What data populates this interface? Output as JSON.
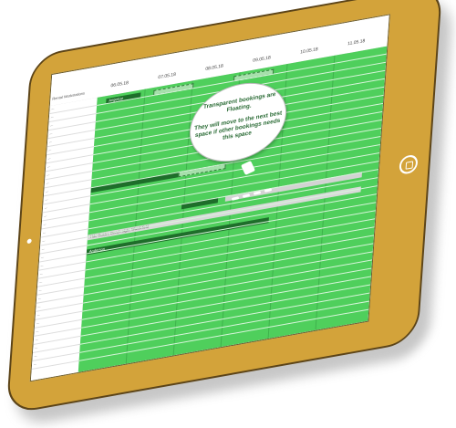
{
  "dates": [
    "06.05.18",
    "07.05.18",
    "08.05.18",
    "09.05.18",
    "10.05.18",
    "11.05.18"
  ],
  "names_header": "Rental Workstations",
  "row_names": [
    "—",
    "—",
    "—",
    "—",
    "—",
    "—",
    "—",
    "—",
    "—",
    "—",
    "—",
    "—",
    "—",
    "—",
    "—",
    "—",
    "—",
    "—",
    "—",
    "—",
    "—",
    "—",
    "—",
    "—",
    "—",
    "—",
    "—",
    "—",
    "—",
    "—",
    "—",
    "—"
  ],
  "bookings": {
    "a1": "Angelcar",
    "f1": "",
    "f2": "",
    "f3": "",
    "gbar": "",
    "split": "Hdc Guider, Bench sigle, Wardefield",
    "a2": "Anderson"
  },
  "callout": {
    "line1": "Transparent bookings are Floating.",
    "line2": "They will move to the next best space if other bookings needs this space"
  },
  "colors": {
    "frame": "#d3a33a",
    "grid": "#4fcf5c",
    "booking": "#1e6e2a"
  }
}
